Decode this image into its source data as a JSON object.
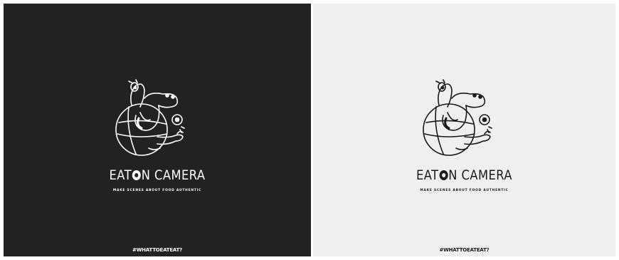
{
  "brand": {
    "title_before": "EAT",
    "title_after": "N CAMERA",
    "tagline": "MAKE SCENES ABOUT FOOD AUTHENTIC",
    "hashtag": "#WHATTOEATEAT?"
  },
  "panels": [
    {
      "variant": "dark",
      "background": "#222222",
      "ink": "#ffffff"
    },
    {
      "variant": "light",
      "background": "#efefef",
      "ink": "#1a1a1a"
    }
  ]
}
